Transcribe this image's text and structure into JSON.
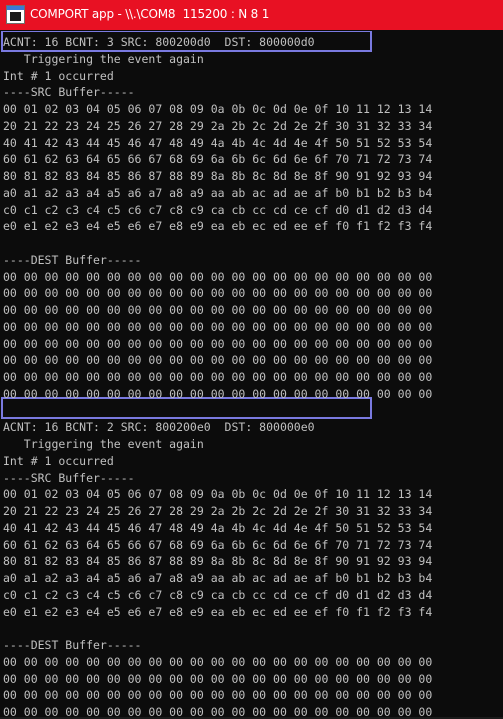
{
  "window": {
    "title": "COMPORT app - \\\\.\\COM8  115200 : N 8 1"
  },
  "console": {
    "lines": [
      "ACNT: 16 BCNT: 3 SRC: 800200d0  DST: 800000d0",
      "   Triggering the event again",
      "Int # 1 occurred",
      "----SRC Buffer-----",
      "00 01 02 03 04 05 06 07 08 09 0a 0b 0c 0d 0e 0f 10 11 12 13 14",
      "20 21 22 23 24 25 26 27 28 29 2a 2b 2c 2d 2e 2f 30 31 32 33 34",
      "40 41 42 43 44 45 46 47 48 49 4a 4b 4c 4d 4e 4f 50 51 52 53 54",
      "60 61 62 63 64 65 66 67 68 69 6a 6b 6c 6d 6e 6f 70 71 72 73 74",
      "80 81 82 83 84 85 86 87 88 89 8a 8b 8c 8d 8e 8f 90 91 92 93 94",
      "a0 a1 a2 a3 a4 a5 a6 a7 a8 a9 aa ab ac ad ae af b0 b1 b2 b3 b4",
      "c0 c1 c2 c3 c4 c5 c6 c7 c8 c9 ca cb cc cd ce cf d0 d1 d2 d3 d4",
      "e0 e1 e2 e3 e4 e5 e6 e7 e8 e9 ea eb ec ed ee ef f0 f1 f2 f3 f4",
      "",
      "----DEST Buffer-----",
      "00 00 00 00 00 00 00 00 00 00 00 00 00 00 00 00 00 00 00 00 00",
      "00 00 00 00 00 00 00 00 00 00 00 00 00 00 00 00 00 00 00 00 00",
      "00 00 00 00 00 00 00 00 00 00 00 00 00 00 00 00 00 00 00 00 00",
      "00 00 00 00 00 00 00 00 00 00 00 00 00 00 00 00 00 00 00 00 00",
      "00 00 00 00 00 00 00 00 00 00 00 00 00 00 00 00 00 00 00 00 00",
      "00 00 00 00 00 00 00 00 00 00 00 00 00 00 00 00 00 00 00 00 00",
      "00 00 00 00 00 00 00 00 00 00 00 00 00 00 00 00 00 00 00 00 00",
      "00 00 00 00 00 00 00 00 00 00 00 00 00 00 00 00 00 00 00 00 00",
      "",
      "ACNT: 16 BCNT: 2 SRC: 800200e0  DST: 800000e0",
      "   Triggering the event again",
      "Int # 1 occurred",
      "----SRC Buffer-----",
      "00 01 02 03 04 05 06 07 08 09 0a 0b 0c 0d 0e 0f 10 11 12 13 14",
      "20 21 22 23 24 25 26 27 28 29 2a 2b 2c 2d 2e 2f 30 31 32 33 34",
      "40 41 42 43 44 45 46 47 48 49 4a 4b 4c 4d 4e 4f 50 51 52 53 54",
      "60 61 62 63 64 65 66 67 68 69 6a 6b 6c 6d 6e 6f 70 71 72 73 74",
      "80 81 82 83 84 85 86 87 88 89 8a 8b 8c 8d 8e 8f 90 91 92 93 94",
      "a0 a1 a2 a3 a4 a5 a6 a7 a8 a9 aa ab ac ad ae af b0 b1 b2 b3 b4",
      "c0 c1 c2 c3 c4 c5 c6 c7 c8 c9 ca cb cc cd ce cf d0 d1 d2 d3 d4",
      "e0 e1 e2 e3 e4 e5 e6 e7 e8 e9 ea eb ec ed ee ef f0 f1 f2 f3 f4",
      "",
      "----DEST Buffer-----",
      "00 00 00 00 00 00 00 00 00 00 00 00 00 00 00 00 00 00 00 00 00",
      "00 00 00 00 00 00 00 00 00 00 00 00 00 00 00 00 00 00 00 00 00",
      "00 00 00 00 00 00 00 00 00 00 00 00 00 00 00 00 00 00 00 00 00",
      "00 00 00 00 00 00 00 00 00 00 00 00 00 00 00 00 00 00 00 00 00",
      "00 00 00 00 00 00 00 00 00 00 00 00 00 00 00 00 00 00 00 00 00"
    ]
  },
  "colors": {
    "titlebar": "#e81123",
    "background": "#0c0c0c",
    "text": "#c0c0c0",
    "highlight_border": "#7a7ae0"
  },
  "icons": {
    "app": "terminal-app-icon"
  }
}
